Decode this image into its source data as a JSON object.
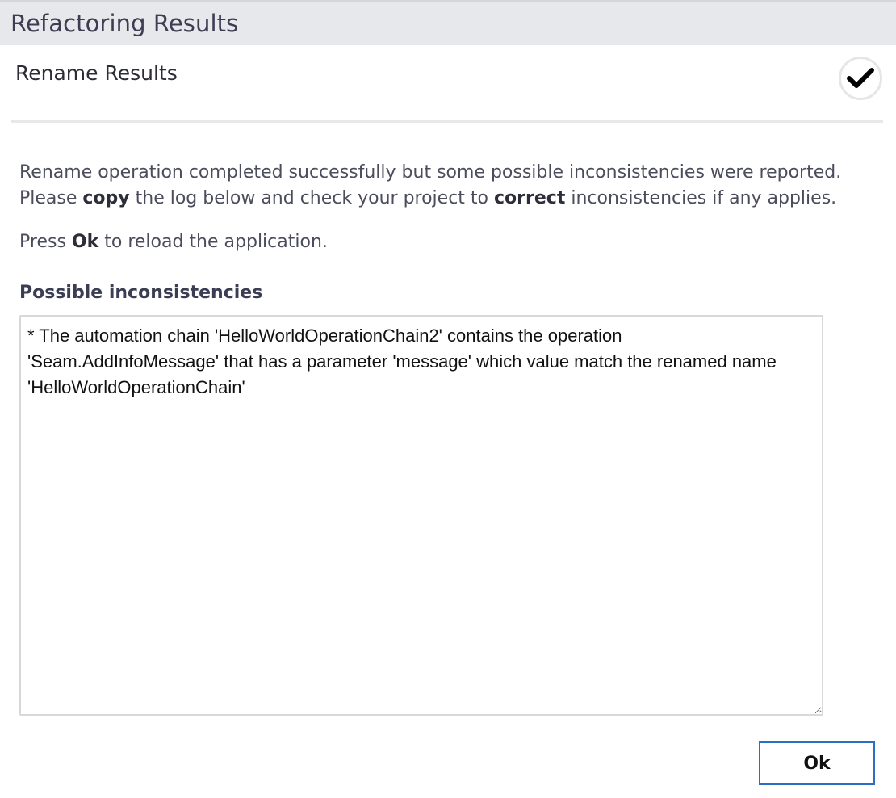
{
  "dialog": {
    "title": "Refactoring Results"
  },
  "header": {
    "title": "Rename Results",
    "status_icon": "checkmark-icon"
  },
  "message": {
    "line1": "Rename operation completed successfully but some possible inconsistencies were reported.",
    "line2_part1": "Please ",
    "line2_bold1": "copy",
    "line2_part2": " the log below and check your project to ",
    "line2_bold2": "correct",
    "line2_part3": " inconsistencies if any applies.",
    "press_part1": "Press ",
    "press_bold": "Ok",
    "press_part2": " to reload the application."
  },
  "log": {
    "label": "Possible inconsistencies",
    "value": "* The automation chain 'HelloWorldOperationChain2' contains the operation 'Seam.AddInfoMessage' that has a parameter 'message' which value match the renamed name 'HelloWorldOperationChain'"
  },
  "footer": {
    "ok_label": "Ok"
  }
}
